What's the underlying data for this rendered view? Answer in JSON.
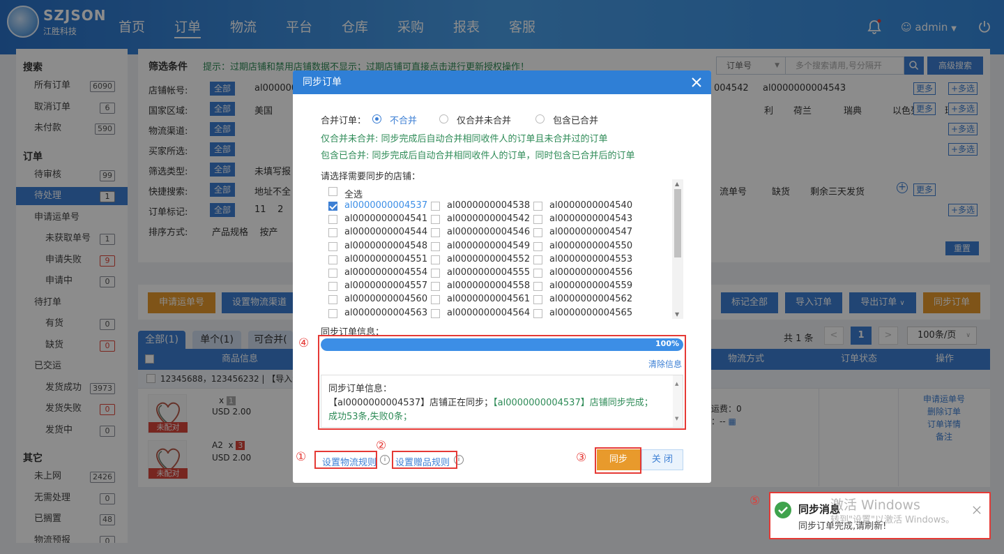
{
  "brand": {
    "name": "SZJSON",
    "sub": "江胜科技"
  },
  "nav": [
    "首页",
    "订单",
    "物流",
    "平台",
    "仓库",
    "采购",
    "报表",
    "客服"
  ],
  "nav_active": "订单",
  "user": {
    "name": "admin"
  },
  "sidebar": {
    "sections": [
      {
        "title": "搜索",
        "items": [
          {
            "label": "所有订单",
            "count": "6090",
            "red": false
          },
          {
            "label": "取消订单",
            "count": "6",
            "red": false
          },
          {
            "label": "未付款",
            "count": "590",
            "red": false
          }
        ]
      },
      {
        "title": "订单",
        "items": [
          {
            "label": "待审核",
            "count": "99",
            "red": false
          },
          {
            "label": "待处理",
            "count": "1",
            "red": false,
            "active": true
          },
          {
            "label": "申请运单号",
            "count": "",
            "red": false
          },
          {
            "label": "未获取单号",
            "count": "1",
            "red": false,
            "sub": true
          },
          {
            "label": "申请失败",
            "count": "9",
            "red": true,
            "sub": true
          },
          {
            "label": "申请中",
            "count": "0",
            "red": false,
            "sub": true
          },
          {
            "label": "待打单",
            "count": "",
            "red": false
          },
          {
            "label": "有货",
            "count": "0",
            "red": false,
            "sub": true
          },
          {
            "label": "缺货",
            "count": "0",
            "red": true,
            "sub": true
          },
          {
            "label": "已交运",
            "count": "",
            "red": false
          },
          {
            "label": "发货成功",
            "count": "3973",
            "red": false,
            "sub": true
          },
          {
            "label": "发货失败",
            "count": "0",
            "red": true,
            "sub": true
          },
          {
            "label": "发货中",
            "count": "0",
            "red": false,
            "sub": true
          }
        ]
      },
      {
        "title": "其它",
        "items": [
          {
            "label": "未上网",
            "count": "2426",
            "red": false
          },
          {
            "label": "无需处理",
            "count": "0",
            "red": false
          },
          {
            "label": "已搁置",
            "count": "48",
            "red": false
          },
          {
            "label": "物流预报",
            "count": "0",
            "red": false
          }
        ]
      }
    ]
  },
  "filter": {
    "title": "筛选条件",
    "hint": "提示：过期店铺和禁用店铺数据不显示；过期店铺可直接点击进行更新授权操作！",
    "search_type": "订单号",
    "search_placeholder": "多个搜索请用,号分隔开",
    "advanced": "高级搜索",
    "all": "全部",
    "more": "更多",
    "multi": "+多选",
    "reset": "重置",
    "rows": [
      {
        "label": "店铺帐号:",
        "left": "al000000",
        "right": [
          "004542",
          "al0000000004543"
        ]
      },
      {
        "label": "国家区域:",
        "left": "美国",
        "right": [
          "利",
          "荷兰",
          "瑞典",
          "以色列",
          "瑞士"
        ]
      },
      {
        "label": "物流渠道:",
        "left": "",
        "right": []
      },
      {
        "label": "买家所选:",
        "left": "",
        "right": []
      },
      {
        "label": "筛选类型:",
        "left": "未填写报",
        "right": []
      },
      {
        "label": "快捷搜索:",
        "left": "地址不全",
        "right": [
          "流单号",
          "缺货",
          "剩余三天发货"
        ]
      },
      {
        "label": "订单标记:",
        "left": "11    2",
        "right": []
      },
      {
        "label": "排序方式:",
        "left": "产品规格    按产",
        "right": []
      }
    ]
  },
  "actions": {
    "left": [
      "申请运单号",
      "设置物流渠道"
    ],
    "right": [
      "标记全部",
      "导入订单",
      "导出订单",
      "同步订单"
    ]
  },
  "tabs": [
    "全部(1)",
    "单个(1)",
    "可合并("
  ],
  "pager": {
    "total": "共 1 条",
    "page": "1",
    "size": "100条/页"
  },
  "table": {
    "headers": [
      "商品信息",
      "物流方式",
      "订单状态",
      "操作"
    ],
    "order_line": "12345688，123456232  |  【导入订",
    "items": [
      {
        "qty": "1",
        "price": "USD 2.00",
        "tag": "未配对",
        "sku": ""
      },
      {
        "qty": "3",
        "price": "USD 2.00",
        "tag": "未配对",
        "sku": "A2"
      }
    ],
    "freight": "运费：0",
    "freight2": "：--",
    "ops": [
      "申请运单号",
      "删除订单",
      "订单详情",
      "备注"
    ]
  },
  "dialog": {
    "title": "同步订单",
    "merge_label": "合并订单：",
    "merge_options": [
      "不合并",
      "仅合并未合并",
      "包含已合并"
    ],
    "merge_selected": 0,
    "note1": "仅合并未合并: 同步完成后自动合并相同收件人的订单且未合并过的订单",
    "note2": "包含已合并: 同步完成后自动合并相同收件人的订单，同时包含已合并后的订单",
    "shop_label": "请选择需要同步的店铺：",
    "select_all": "全选",
    "shops": [
      "al0000000004537",
      "al0000000004538",
      "al0000000004540",
      "al0000000004541",
      "al0000000004542",
      "al0000000004543",
      "al0000000004544",
      "al0000000004546",
      "al0000000004547",
      "al0000000004548",
      "al0000000004549",
      "al0000000004550",
      "al0000000004551",
      "al0000000004552",
      "al0000000004553",
      "al0000000004554",
      "al0000000004555",
      "al0000000004556",
      "al0000000004557",
      "al0000000004558",
      "al0000000004559",
      "al0000000004560",
      "al0000000004561",
      "al0000000004562",
      "al0000000004563",
      "al0000000004564",
      "al0000000004565"
    ],
    "checked_shop": "al0000000004537",
    "info_label": "同步订单信息：",
    "progress": 1.0,
    "progress_text": "100%",
    "clear": "清除信息",
    "log_title": "同步订单信息：",
    "log_line1_a": "【al0000000004537】店铺正在同步；",
    "log_line1_b": "【al0000000004537】店铺同步完成；",
    "log_line2": "成功53条,失败0条；",
    "link1": "设置物流规则",
    "link2": "设置赠品规则",
    "sync": "同步",
    "close": "关 闭",
    "markers": [
      "①",
      "②",
      "③",
      "④",
      "⑤"
    ]
  },
  "toast": {
    "title": "同步消息",
    "message": "同步订单完成,请刷新!",
    "watermark1": "激活 Windows",
    "watermark2": "转到\"设置\"以激活 Windows。"
  }
}
